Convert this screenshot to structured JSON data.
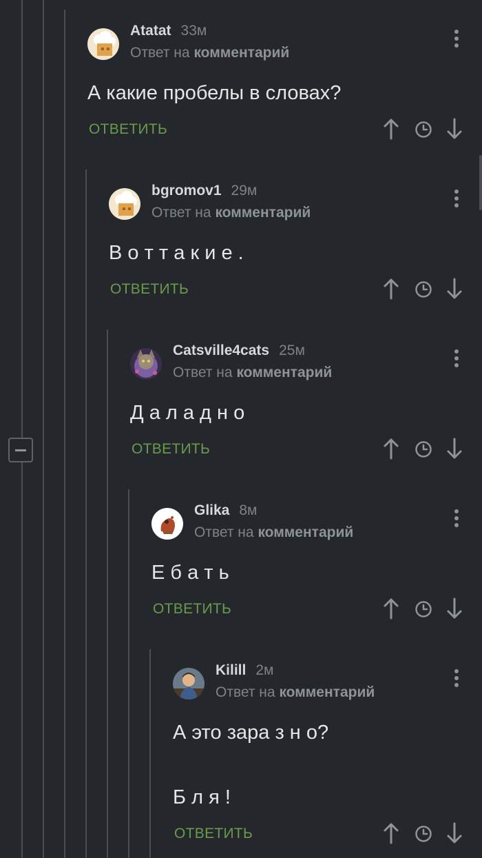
{
  "comments": [
    {
      "username": "Atatat",
      "time": "33м",
      "reply_prefix": "Ответ на",
      "reply_target": "комментарий",
      "lines": [
        "А какие пробелы в словах?"
      ],
      "reply_label": "ОТВЕТИТЬ",
      "avatar_icon": "chef-hat-avatar"
    },
    {
      "username": "bgromov1",
      "time": "29м",
      "reply_prefix": "Ответ на",
      "reply_target": "комментарий",
      "lines": [
        "В о т   т а к и е ."
      ],
      "reply_label": "ОТВЕТИТЬ",
      "avatar_icon": "chef-hat-avatar"
    },
    {
      "username": "Catsville4cats",
      "time": "25м",
      "reply_prefix": "Ответ на",
      "reply_target": "комментарий",
      "lines": [
        "Д а   л а д н о"
      ],
      "reply_label": "ОТВЕТИТЬ",
      "avatar_icon": "cat-avatar"
    },
    {
      "username": "Glika",
      "time": "8м",
      "reply_prefix": "Ответ на",
      "reply_target": "комментарий",
      "lines": [
        "Е б а т ь"
      ],
      "reply_label": "ОТВЕТИТЬ",
      "avatar_icon": "cartoon-avatar"
    },
    {
      "username": "Kilill",
      "time": "2м",
      "reply_prefix": "Ответ на",
      "reply_target": "комментарий",
      "lines": [
        "А это зара з н о?",
        "Б л я !"
      ],
      "reply_label": "ОТВЕТИТЬ",
      "avatar_icon": "person-avatar"
    }
  ],
  "icons": {
    "upvote": "arrow-up-icon",
    "save": "clock-icon",
    "downvote": "arrow-down-icon",
    "menu": "more-vertical-icon",
    "collapse": "minus-icon"
  },
  "colors": {
    "background": "#24272b",
    "reply_green": "#6a9a4c",
    "text": "#e4e6e8",
    "muted": "#7e8389"
  }
}
